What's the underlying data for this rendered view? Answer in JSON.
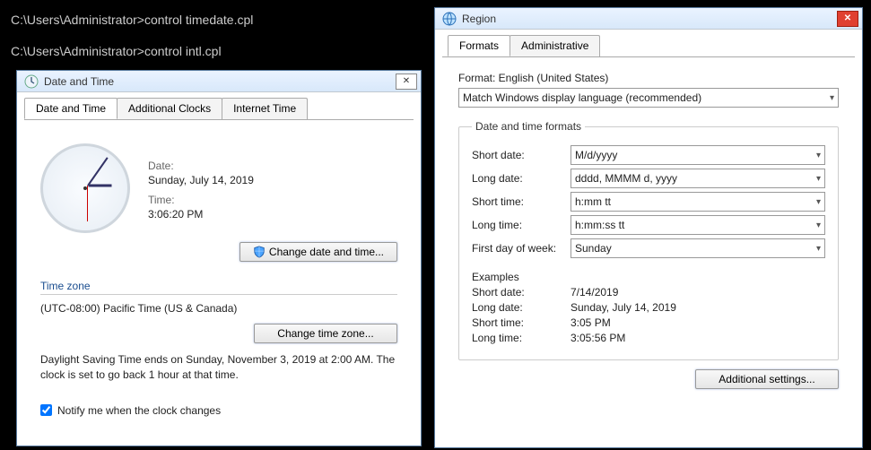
{
  "terminal": {
    "prompt": "C:\\Users\\Administrator>",
    "cmd1": "control timedate.cpl",
    "cmd2": "control intl.cpl"
  },
  "dateTimeWindow": {
    "title": "Date and Time",
    "tabs": {
      "t1": "Date and Time",
      "t2": "Additional Clocks",
      "t3": "Internet Time"
    },
    "dateLabel": "Date:",
    "dateValue": "Sunday, July 14, 2019",
    "timeLabel": "Time:",
    "timeValue": "3:06:20 PM",
    "changeDateTime": "Change date and time...",
    "timeZoneHeading": "Time zone",
    "timeZoneValue": "(UTC-08:00) Pacific Time (US & Canada)",
    "changeTimeZone": "Change time zone...",
    "dstMsg": "Daylight Saving Time ends on Sunday, November 3, 2019 at 2:00 AM. The clock is set to go back 1 hour at that time.",
    "notifyLabel": "Notify me when the clock changes"
  },
  "regionWindow": {
    "title": "Region",
    "tabs": {
      "t1": "Formats",
      "t2": "Administrative"
    },
    "formatLabel": "Format: English (United States)",
    "formatSelect": "Match Windows display language (recommended)",
    "groupTitle": "Date and time formats",
    "rows": {
      "shortDateLabel": "Short date:",
      "shortDateVal": "M/d/yyyy",
      "longDateLabel": "Long date:",
      "longDateVal": "dddd, MMMM d, yyyy",
      "shortTimeLabel": "Short time:",
      "shortTimeVal": "h:mm tt",
      "longTimeLabel": "Long time:",
      "longTimeVal": "h:mm:ss tt",
      "firstDayLabel": "First day of week:",
      "firstDayVal": "Sunday"
    },
    "examplesTitle": "Examples",
    "examples": {
      "shortDateLabel": "Short date:",
      "shortDateVal": "7/14/2019",
      "longDateLabel": "Long date:",
      "longDateVal": "Sunday, July 14, 2019",
      "shortTimeLabel": "Short time:",
      "shortTimeVal": "3:05 PM",
      "longTimeLabel": "Long time:",
      "longTimeVal": "3:05:56 PM"
    },
    "additionalSettings": "Additional settings..."
  }
}
